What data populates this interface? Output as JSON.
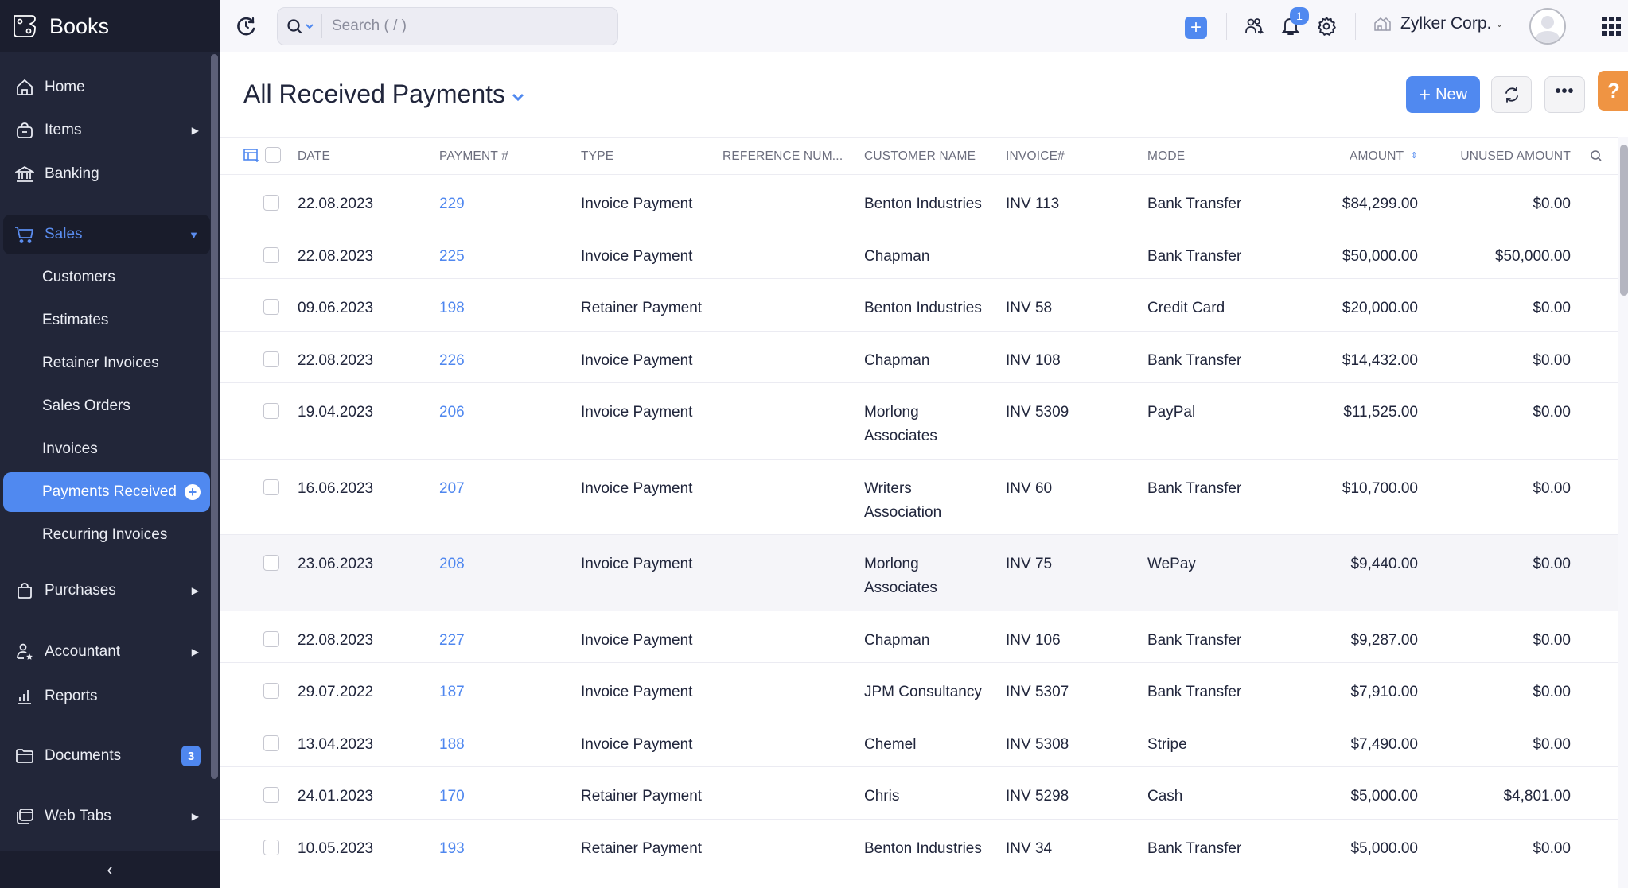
{
  "app": {
    "brand_name": "Books"
  },
  "sidebar": {
    "items": [
      {
        "label": "Home",
        "icon": "home-icon"
      },
      {
        "label": "Items",
        "icon": "basket-icon",
        "has_submenu": true
      },
      {
        "label": "Banking",
        "icon": "bank-icon"
      },
      {
        "label": "Sales",
        "icon": "cart-icon",
        "expanded": true
      },
      {
        "label": "Purchases",
        "icon": "shopping-bag-icon",
        "has_submenu": true
      },
      {
        "label": "Accountant",
        "icon": "accountant-icon",
        "has_submenu": true
      },
      {
        "label": "Reports",
        "icon": "bar-chart-icon"
      },
      {
        "label": "Documents",
        "icon": "folder-icon",
        "badge": "3"
      },
      {
        "label": "Web Tabs",
        "icon": "web-tabs-icon",
        "has_submenu": true
      }
    ],
    "sales_submenu": [
      {
        "label": "Customers"
      },
      {
        "label": "Estimates"
      },
      {
        "label": "Retainer Invoices"
      },
      {
        "label": "Sales Orders"
      },
      {
        "label": "Invoices"
      },
      {
        "label": "Payments Received",
        "active": true
      },
      {
        "label": "Recurring Invoices"
      }
    ],
    "collapse_glyph": "‹"
  },
  "topbar": {
    "search_placeholder": "Search ( / )",
    "notification_count": "1",
    "organization": "Zylker Corp."
  },
  "page": {
    "title": "All Received Payments",
    "new_button_label": "New"
  },
  "table": {
    "columns": [
      {
        "key": "date",
        "label": "DATE"
      },
      {
        "key": "payment_no",
        "label": "PAYMENT #"
      },
      {
        "key": "type",
        "label": "TYPE"
      },
      {
        "key": "reference",
        "label": "REFERENCE NUM..."
      },
      {
        "key": "customer",
        "label": "CUSTOMER NAME"
      },
      {
        "key": "invoice",
        "label": "INVOICE#"
      },
      {
        "key": "mode",
        "label": "MODE"
      },
      {
        "key": "amount",
        "label": "AMOUNT",
        "sortable": true
      },
      {
        "key": "unused",
        "label": "UNUSED AMOUNT"
      }
    ],
    "rows": [
      {
        "date": "22.08.2023",
        "payment_no": "229",
        "type": "Invoice Payment",
        "reference": "",
        "customer": "Benton Industries",
        "invoice": "INV 113",
        "mode": "Bank Transfer",
        "amount": "$84,299.00",
        "unused": "$0.00"
      },
      {
        "date": "22.08.2023",
        "payment_no": "225",
        "type": "Invoice Payment",
        "reference": "",
        "customer": "Chapman",
        "invoice": "",
        "mode": "Bank Transfer",
        "amount": "$50,000.00",
        "unused": "$50,000.00"
      },
      {
        "date": "09.06.2023",
        "payment_no": "198",
        "type": "Retainer Payment",
        "reference": "",
        "customer": "Benton Industries",
        "invoice": "INV 58",
        "mode": "Credit Card",
        "amount": "$20,000.00",
        "unused": "$0.00"
      },
      {
        "date": "22.08.2023",
        "payment_no": "226",
        "type": "Invoice Payment",
        "reference": "",
        "customer": "Chapman",
        "invoice": "INV 108",
        "mode": "Bank Transfer",
        "amount": "$14,432.00",
        "unused": "$0.00"
      },
      {
        "date": "19.04.2023",
        "payment_no": "206",
        "type": "Invoice Payment",
        "reference": "",
        "customer": "Morlong Associates",
        "invoice": "INV 5309",
        "mode": "PayPal",
        "amount": "$11,525.00",
        "unused": "$0.00"
      },
      {
        "date": "16.06.2023",
        "payment_no": "207",
        "type": "Invoice Payment",
        "reference": "",
        "customer": "Writers Association",
        "invoice": "INV 60",
        "mode": "Bank Transfer",
        "amount": "$10,700.00",
        "unused": "$0.00"
      },
      {
        "date": "23.06.2023",
        "payment_no": "208",
        "type": "Invoice Payment",
        "reference": "",
        "customer": "Morlong Associates",
        "invoice": "INV 75",
        "mode": "WePay",
        "amount": "$9,440.00",
        "unused": "$0.00"
      },
      {
        "date": "22.08.2023",
        "payment_no": "227",
        "type": "Invoice Payment",
        "reference": "",
        "customer": "Chapman",
        "invoice": "INV 106",
        "mode": "Bank Transfer",
        "amount": "$9,287.00",
        "unused": "$0.00"
      },
      {
        "date": "29.07.2022",
        "payment_no": "187",
        "type": "Invoice Payment",
        "reference": "",
        "customer": "JPM Consultancy",
        "invoice": "INV 5307",
        "mode": "Bank Transfer",
        "amount": "$7,910.00",
        "unused": "$0.00"
      },
      {
        "date": "13.04.2023",
        "payment_no": "188",
        "type": "Invoice Payment",
        "reference": "",
        "customer": "Chemel",
        "invoice": "INV 5308",
        "mode": "Stripe",
        "amount": "$7,490.00",
        "unused": "$0.00"
      },
      {
        "date": "24.01.2023",
        "payment_no": "170",
        "type": "Retainer Payment",
        "reference": "",
        "customer": "Chris",
        "invoice": "INV 5298",
        "mode": "Cash",
        "amount": "$5,000.00",
        "unused": "$4,801.00"
      },
      {
        "date": "10.05.2023",
        "payment_no": "193",
        "type": "Retainer Payment",
        "reference": "",
        "customer": "Benton Industries",
        "invoice": "INV 34",
        "mode": "Bank Transfer",
        "amount": "$5,000.00",
        "unused": "$0.00"
      }
    ]
  },
  "colors": {
    "sidebar_bg": "#222639",
    "accent": "#5089f0",
    "help_button": "#ef9443",
    "link": "#4f87ef"
  }
}
